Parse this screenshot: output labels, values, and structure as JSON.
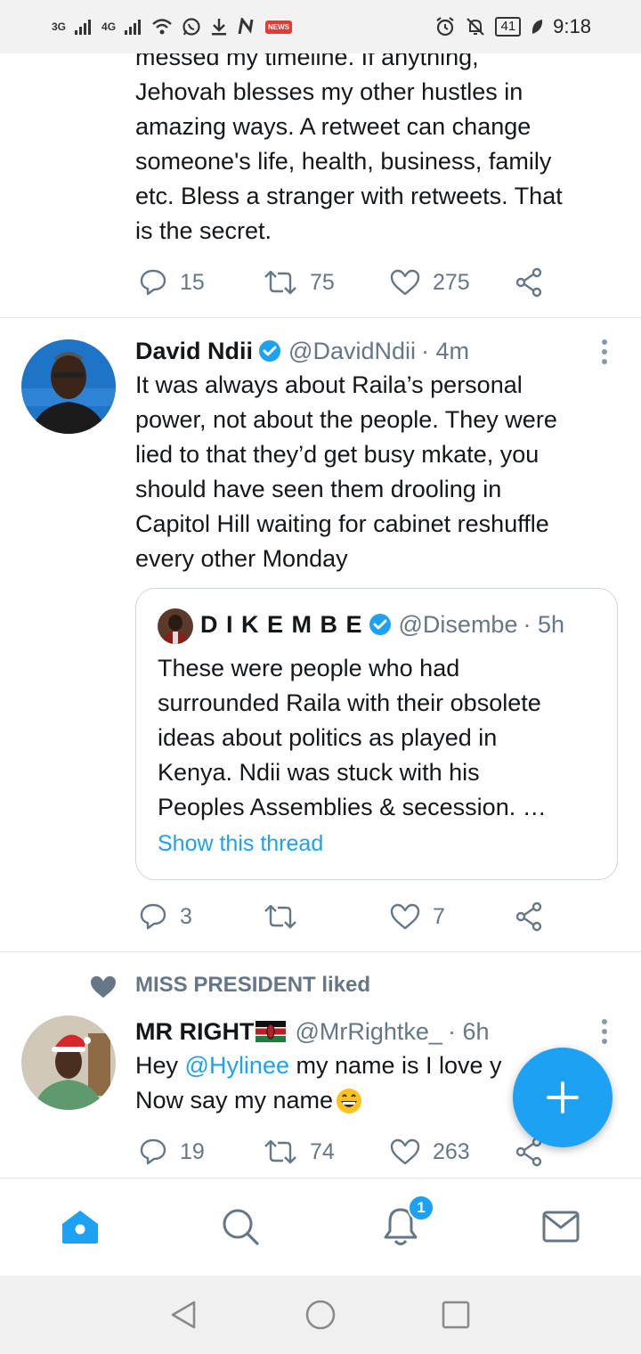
{
  "status_bar": {
    "network1": "3G",
    "network2": "4G",
    "battery": "41",
    "time": "9:18",
    "news_badge": "NEWS"
  },
  "tweets": [
    {
      "text_lines": [
        "messed my timeline. If anything,",
        "Jehovah blesses my other hustles in",
        "amazing ways. A retweet can change",
        "someone's life, health, business, family",
        "etc. Bless a stranger with retweets. That",
        "is the secret."
      ],
      "replies": "15",
      "retweets": "75",
      "likes": "275"
    },
    {
      "name": "David Ndii",
      "handle": "@DavidNdii",
      "time": "· 4m",
      "text_lines": [
        "It was always about Raila’s personal",
        "power, not about the people. They were",
        "lied to that they’d get busy mkate, you",
        "should have seen them drooling in",
        "Capitol Hill waiting for cabinet reshuffle",
        "every other Monday"
      ],
      "quote": {
        "name": "D I K E M B E",
        "handle": "@Disembe",
        "time": "· 5h",
        "text_lines": [
          "These were people who had",
          "surrounded Raila with their obsolete",
          "ideas about politics as played in",
          "Kenya. Ndii was stuck with his",
          "Peoples Assemblies & secession. …"
        ],
        "show_thread": "Show this thread"
      },
      "replies": "3",
      "retweets": "",
      "likes": "7"
    },
    {
      "social_context": "MISS PRESIDENT liked",
      "name": "MR RIGHT",
      "flag": "🇰🇪",
      "handle": "@MrRightke_",
      "time": "· 6h",
      "text_prefix": "Hey ",
      "mention": "@Hylinee",
      "text_suffix": " my name is I love y",
      "text_line2": "Now say my name",
      "emoji": "😁",
      "replies": "19",
      "retweets": "74",
      "likes": "263"
    }
  ],
  "tabbar": {
    "notifications_badge": "1"
  },
  "colors": {
    "accent": "#1da1f2",
    "text": "#14171a",
    "secondary": "#657786",
    "divider": "#e1e8ed"
  }
}
